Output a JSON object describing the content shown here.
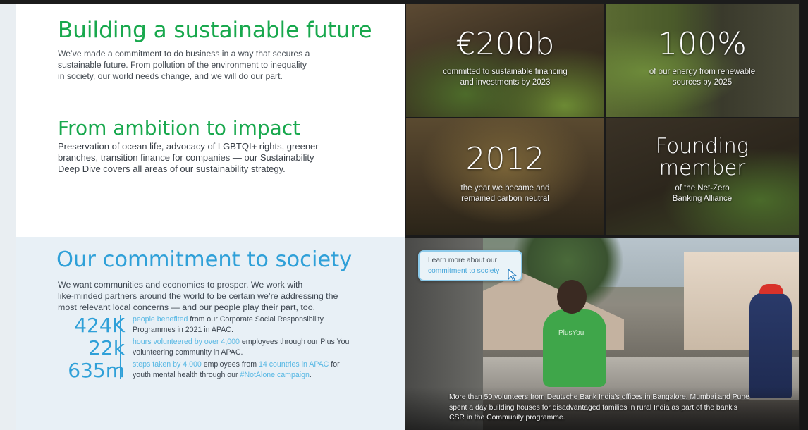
{
  "colors": {
    "green": "#18a84d",
    "blue": "#2fa0d8",
    "light_blue": "#58b8e4",
    "body_text": "#444b52"
  },
  "sustainable": {
    "title": "Building a sustainable future",
    "body": [
      "We’ve made a commitment to do business in a way that secures a",
      "sustainable future. From pollution of the environment to inequality",
      "in society, our world needs change, and we will do our part."
    ]
  },
  "ambition": {
    "title": "From ambition to impact",
    "body": [
      "Preservation of ocean life, advocacy of LGBTQI+ rights, greener",
      "branches, transition finance for companies — our Sustainability",
      "Deep Dive covers all areas of our sustainability strategy."
    ]
  },
  "tiles": [
    {
      "value": "€200b",
      "caption": [
        "committed to sustainable financing",
        "and investments by 2023"
      ]
    },
    {
      "value": "100%",
      "caption": [
        "of our energy from renewable",
        "sources by 2025"
      ]
    },
    {
      "value": "2012",
      "caption": [
        "the year we became and",
        "remained carbon neutral"
      ]
    },
    {
      "value_lines": [
        "Founding",
        "member"
      ],
      "caption": [
        "of the Net-Zero",
        "Banking Alliance"
      ]
    }
  ],
  "society": {
    "title": "Our commitment to society",
    "body": [
      "We want communities and economies to prosper. We work with",
      "like-minded partners around the world to be certain we’re addressing the",
      "most relevant local concerns — and our people play their part, too."
    ],
    "stats": [
      {
        "value": "424K",
        "hl1": "people benefited",
        "rest1": " from our Corporate Social Responsibility",
        "line2": "Programmes in 2021 in APAC."
      },
      {
        "value": "22k",
        "hl1": "hours volunteered by over 4,000",
        "rest1": " employees through our Plus You",
        "line2": "volunteering community in APAC."
      },
      {
        "value": "635m",
        "hl1": "steps taken by 4,000",
        "mid1": " employees from ",
        "hl2": "14 countries in APAC",
        "rest1": " for",
        "line2a": "youth mental health through our ",
        "line2hl": "#NotAlone campaign",
        "line2b": "."
      }
    ]
  },
  "photo": {
    "button_line1": "Learn more about our",
    "button_link": "commitment to society",
    "shirt_text": "PlusYou",
    "caption": [
      "More than 50 volunteers from Deutsche Bank India’s offices in Bangalore, Mumbai and Pune",
      "spent a day building houses for disadvantaged families in rural India as part of the bank’s",
      "CSR in the Community programme."
    ]
  }
}
